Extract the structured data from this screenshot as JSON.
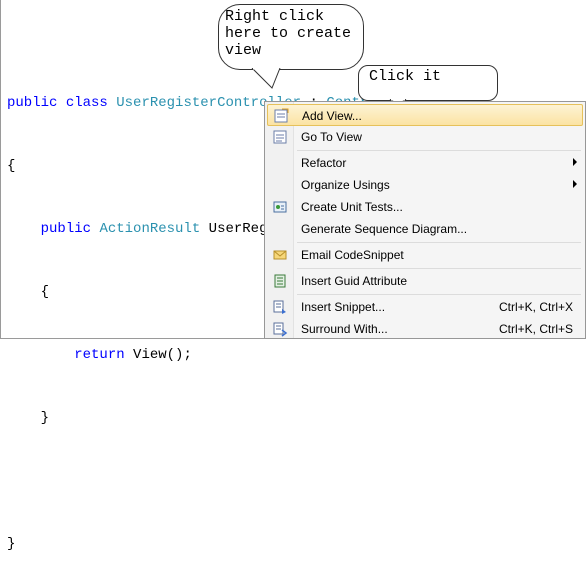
{
  "code": {
    "l1": {
      "kw1": "public",
      "kw2": "class",
      "cls": "UserRegisterController",
      "sep": " : ",
      "base": "Controller"
    },
    "l2": "{",
    "l3": {
      "kw": "public",
      "type": "ActionResult",
      "rest": "UserRegister()"
    },
    "l4": "{",
    "l5": {
      "kw": "return",
      "rest": "View();"
    },
    "l6": "}",
    "l7": "}"
  },
  "callouts": {
    "right_click": "Right click\nhere to create\nview",
    "click_it": "Click it"
  },
  "menu": {
    "items": [
      {
        "label": "Add View...",
        "shortcut": "",
        "icon": "add-view-icon",
        "submenu": false,
        "highlighted": true
      },
      {
        "label": "Go To View",
        "shortcut": "",
        "icon": "go-to-view-icon",
        "submenu": false
      },
      {
        "label": "Refactor",
        "shortcut": "",
        "icon": "",
        "submenu": true
      },
      {
        "label": "Organize Usings",
        "shortcut": "",
        "icon": "",
        "submenu": true
      },
      {
        "label": "Create Unit Tests...",
        "shortcut": "",
        "icon": "unit-test-icon",
        "submenu": false
      },
      {
        "label": "Generate Sequence Diagram...",
        "shortcut": "",
        "icon": "",
        "submenu": false
      },
      {
        "label": "Email CodeSnippet",
        "shortcut": "",
        "icon": "email-icon",
        "submenu": false
      },
      {
        "label": "Insert Guid Attribute",
        "shortcut": "",
        "icon": "guid-icon",
        "submenu": false
      },
      {
        "label": "Insert Snippet...",
        "shortcut": "Ctrl+K, Ctrl+X",
        "icon": "snippet-icon",
        "submenu": false
      },
      {
        "label": "Surround With...",
        "shortcut": "Ctrl+K, Ctrl+S",
        "icon": "surround-icon",
        "submenu": false
      }
    ]
  },
  "colors": {
    "keyword": "#0000ff",
    "type": "#2b91af",
    "highlight": "#fbe3a3"
  }
}
